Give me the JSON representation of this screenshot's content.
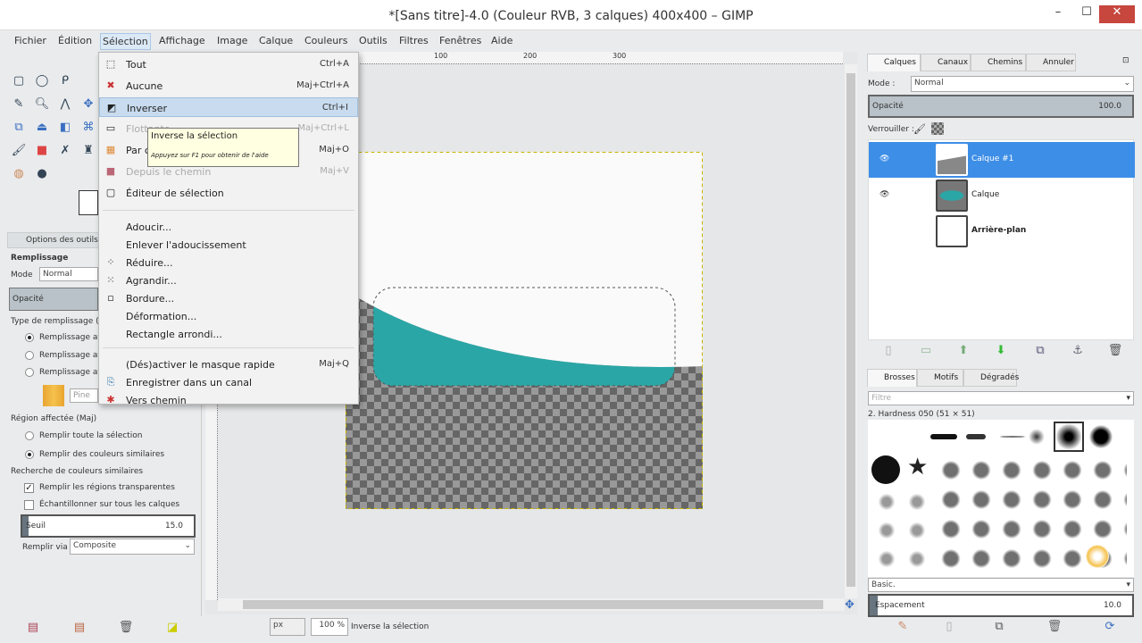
{
  "window": {
    "title": "*[Sans titre]-4.0 (Couleur RVB, 3 calques) 400x400 – GIMP",
    "minimize": "–",
    "maximize": "☐",
    "close": "✕"
  },
  "menubar": [
    "Fichier",
    "Édition",
    "Sélection",
    "Affichage",
    "Image",
    "Calque",
    "Couleurs",
    "Outils",
    "Filtres",
    "Fenêtres",
    "Aide"
  ],
  "selection_menu": [
    {
      "label": "Tout",
      "shortcut": "Ctrl+A",
      "icon": "select-all-icon",
      "glyph": "⬚"
    },
    {
      "label": "Aucune",
      "shortcut": "Maj+Ctrl+A",
      "icon": "select-none-icon",
      "glyph": "✖"
    },
    {
      "label": "Inverser",
      "shortcut": "Ctrl+I",
      "icon": "invert-icon",
      "glyph": "◩",
      "highlight": true
    },
    {
      "label": "Flottante",
      "shortcut": "Maj+Ctrl+L",
      "icon": "float-icon",
      "glyph": "▭",
      "disabled": true
    },
    {
      "label": "Par couleur",
      "shortcut": "Maj+O",
      "icon": "by-color-icon",
      "glyph": "▦"
    },
    {
      "label": "Depuis le chemin",
      "shortcut": "Maj+V",
      "icon": "from-path-icon",
      "glyph": "■",
      "disabled": true
    },
    {
      "label": "Éditeur de sélection",
      "shortcut": "",
      "icon": "selection-editor-icon",
      "glyph": "▢"
    },
    {
      "sep": true
    },
    {
      "label": "Adoucir...",
      "shortcut": ""
    },
    {
      "label": "Enlever l'adoucissement",
      "shortcut": ""
    },
    {
      "label": "Réduire...",
      "shortcut": "",
      "icon": "shrink-icon",
      "glyph": "⁘"
    },
    {
      "label": "Agrandir...",
      "shortcut": "",
      "icon": "grow-icon",
      "glyph": "⁙"
    },
    {
      "label": "Bordure...",
      "shortcut": "",
      "icon": "border-icon",
      "glyph": "▫"
    },
    {
      "label": "Déformation...",
      "shortcut": ""
    },
    {
      "label": "Rectangle arrondi...",
      "shortcut": ""
    },
    {
      "sep": true
    },
    {
      "label": "(Dés)activer le masque rapide",
      "shortcut": "Maj+Q"
    },
    {
      "label": "Enregistrer dans un canal",
      "shortcut": "",
      "icon": "save-channel-icon",
      "glyph": "⎘"
    },
    {
      "label": "Vers chemin",
      "shortcut": "",
      "icon": "to-path-icon",
      "glyph": "✱"
    }
  ],
  "tooltip": {
    "title": "Inverse la sélection",
    "hint": "Appuyez sur F1 pour obtenir de l'aide"
  },
  "tool_options": {
    "tab": "Options des outils",
    "section": "Remplissage",
    "mode_label": "Mode",
    "mode_value": "Normal",
    "opacity_label": "Opacité",
    "fill_type_label": "Type de remplissage (Alt)",
    "fill_types": [
      "Remplissage avec la couleur de PP",
      "Remplissage avec la couleur d'AP",
      "Remplissage avec un motif"
    ],
    "pattern_name": "Pine",
    "region_label": "Région affectée (Maj)",
    "regions": [
      "Remplir toute la sélection",
      "Remplir des couleurs similaires"
    ],
    "similar_label": "Recherche de couleurs similaires",
    "fill_transparent": "Remplir les régions transparentes",
    "sample_merged": "Échantillonner sur tous les calques",
    "threshold_label": "Seuil",
    "threshold_value": "15.0",
    "fill_by_label": "Remplir via",
    "fill_by_value": "Composite"
  },
  "layers_panel": {
    "tabs": [
      "Calques",
      "Canaux",
      "Chemins",
      "Annuler"
    ],
    "mode_label": "Mode :",
    "mode_value": "Normal",
    "opacity_label": "Opacité",
    "opacity_value": "100.0",
    "lock_label": "Verrouiller :",
    "layers": [
      {
        "name": "Calque #1",
        "selected": true
      },
      {
        "name": "Calque"
      },
      {
        "name": "Arrière-plan"
      }
    ]
  },
  "brushes_panel": {
    "tabs": [
      "Brosses",
      "Motifs",
      "Dégradés"
    ],
    "filter": "Filtre",
    "brush_name": "2. Hardness 050 (51 × 51)",
    "preset": "Basic.",
    "spacing_label": "Espacement",
    "spacing_value": "10.0"
  },
  "status": {
    "unit": "px",
    "zoom": "100 %",
    "message": "Inverse la sélection"
  },
  "ruler": {
    "labels": [
      "100",
      "200",
      "300"
    ]
  },
  "colors": {
    "teal": "#2ba6a6",
    "selection": "#3d8ee6"
  }
}
